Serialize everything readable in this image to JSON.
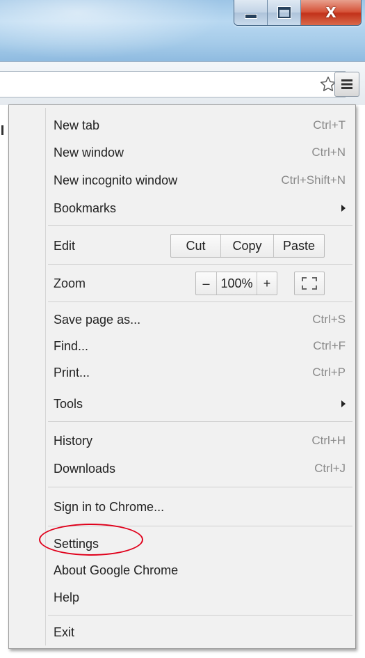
{
  "window": {
    "close_glyph": "X"
  },
  "menu": {
    "items_top": [
      {
        "label": "New tab",
        "shortcut": "Ctrl+T"
      },
      {
        "label": "New window",
        "shortcut": "Ctrl+N"
      },
      {
        "label": "New incognito window",
        "shortcut": "Ctrl+Shift+N"
      },
      {
        "label": "Bookmarks",
        "shortcut": ""
      }
    ],
    "edit": {
      "label": "Edit",
      "cut": "Cut",
      "copy": "Copy",
      "paste": "Paste"
    },
    "zoom": {
      "label": "Zoom",
      "minus": "–",
      "level": "100%",
      "plus": "+"
    },
    "items_mid": [
      {
        "label": "Save page as...",
        "shortcut": "Ctrl+S"
      },
      {
        "label": "Find...",
        "shortcut": "Ctrl+F"
      },
      {
        "label": "Print...",
        "shortcut": "Ctrl+P"
      },
      {
        "label": "Tools",
        "shortcut": ""
      }
    ],
    "items_history": [
      {
        "label": "History",
        "shortcut": "Ctrl+H"
      },
      {
        "label": "Downloads",
        "shortcut": "Ctrl+J"
      }
    ],
    "sign_in": "Sign in to Chrome...",
    "items_bottom": [
      {
        "label": "Settings"
      },
      {
        "label": "About Google Chrome"
      },
      {
        "label": "Help"
      }
    ],
    "exit": "Exit"
  },
  "colors": {
    "annotation": "#e0001b",
    "close_button": "#c2321a",
    "titlebar": "#a5cbe9"
  },
  "icons": [
    "minimize-icon",
    "maximize-icon",
    "close-icon",
    "star-icon",
    "hamburger-menu-icon",
    "submenu-arrow-icon",
    "fullscreen-icon"
  ]
}
